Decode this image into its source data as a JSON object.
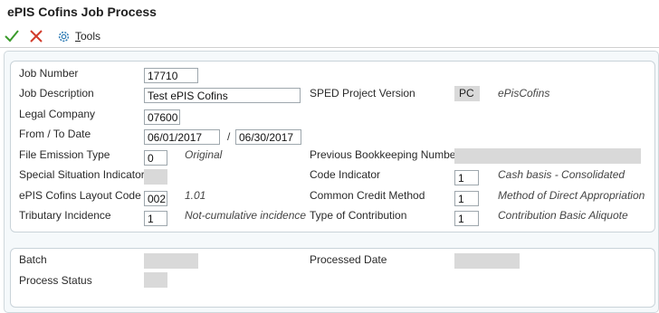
{
  "page": {
    "title": "ePIS Cofins Job Process"
  },
  "toolbar": {
    "ok_icon": "checkmark-icon",
    "cancel_icon": "x-icon",
    "tools_icon": "gear-icon",
    "tools_label_first": "T",
    "tools_label_rest": "ools"
  },
  "colors": {
    "ok": "#3a9a2a",
    "cancel": "#d23b2b",
    "tools_icon": "#2e7bb4"
  },
  "form": {
    "job_number": {
      "label": "Job Number",
      "value": "17710"
    },
    "job_description": {
      "label": "Job Description",
      "value": "Test ePIS Cofins"
    },
    "legal_company": {
      "label": "Legal Company",
      "value": "07600"
    },
    "from_to_date": {
      "label": "From / To Date",
      "from": "06/01/2017",
      "separator": "/",
      "to": "06/30/2017"
    },
    "file_emission_type": {
      "label": "File Emission Type",
      "value": "0",
      "description": "Original"
    },
    "special_situation_indicator": {
      "label": "Special Situation Indicator",
      "value": ""
    },
    "layout_code": {
      "label": "ePIS Cofins Layout Code",
      "value": "002",
      "description": "1.01"
    },
    "tributary_incidence": {
      "label": "Tributary Incidence",
      "value": "1",
      "description": "Not-cumulative incidence"
    },
    "sped_project_version": {
      "label": "SPED Project Version",
      "value": "PC",
      "description": "ePisCofins"
    },
    "previous_bookkeeping_number": {
      "label": "Previous Bookkeeping Number",
      "value": ""
    },
    "code_indicator": {
      "label": "Code Indicator",
      "value": "1",
      "description": "Cash basis - Consolidated"
    },
    "common_credit_method": {
      "label": "Common Credit Method",
      "value": "1",
      "description": "Method of Direct Appropriation"
    },
    "type_of_contribution": {
      "label": "Type of Contribution",
      "value": "1",
      "description": "Contribution Basic Aliquote"
    }
  },
  "status": {
    "batch": {
      "label": "Batch",
      "value": ""
    },
    "processed_date": {
      "label": "Processed Date",
      "value": ""
    },
    "process_status": {
      "label": "Process Status",
      "value": ""
    }
  }
}
